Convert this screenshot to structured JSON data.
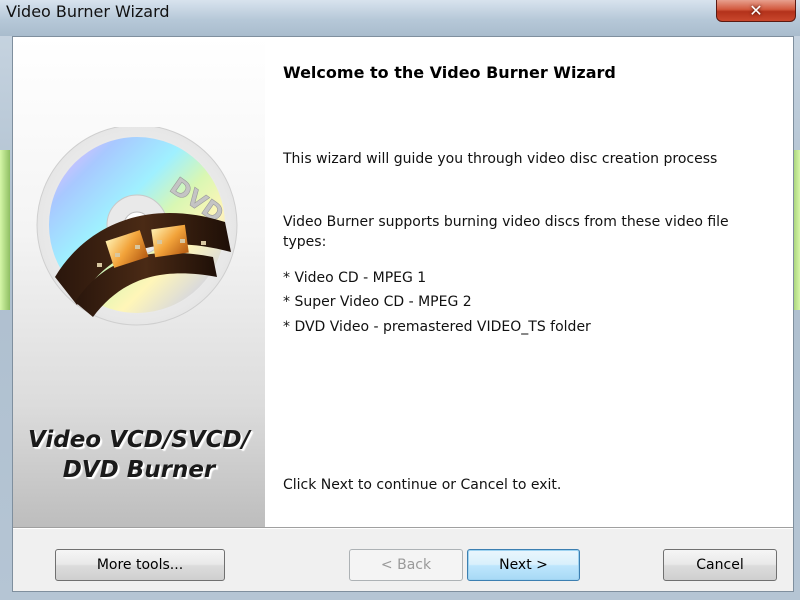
{
  "window": {
    "title": "Video Burner Wizard",
    "close_glyph": "✕"
  },
  "left_panel": {
    "disc_label": "DVD",
    "product_line1": "Video VCD/SVCD/",
    "product_line2": "DVD Burner"
  },
  "content": {
    "heading": "Welcome to the Video Burner Wizard",
    "intro": "This wizard will guide you through video disc creation process",
    "supports": "Video Burner supports burning video discs from these video file types:",
    "formats": [
      "* Video CD - MPEG 1",
      "* Super Video CD - MPEG 2",
      "* DVD Video - premastered VIDEO_TS folder"
    ],
    "footer_hint": "Click Next to continue or Cancel to exit."
  },
  "buttons": {
    "more_tools": "More tools...",
    "back": "< Back",
    "next": "Next >",
    "cancel": "Cancel"
  },
  "colors": {
    "close_red": "#c9472c",
    "default_button_border": "#3c7fb1"
  }
}
